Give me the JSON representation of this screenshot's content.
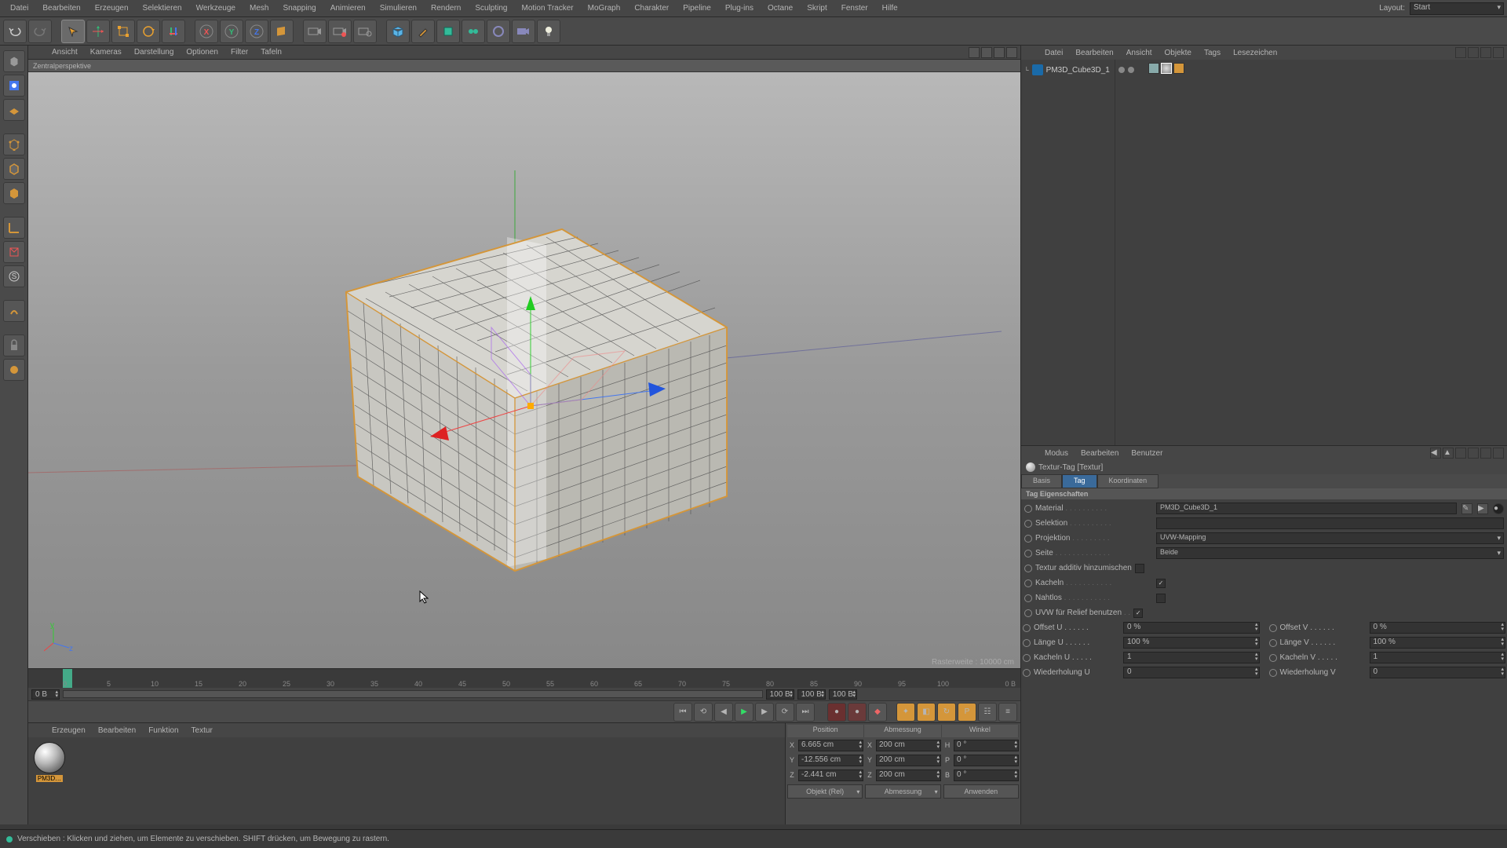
{
  "menubar": [
    "Datei",
    "Bearbeiten",
    "Erzeugen",
    "Selektieren",
    "Werkzeuge",
    "Mesh",
    "Snapping",
    "Animieren",
    "Simulieren",
    "Rendern",
    "Sculpting",
    "Motion Tracker",
    "MoGraph",
    "Charakter",
    "Pipeline",
    "Plug-ins",
    "Octane",
    "Skript",
    "Fenster",
    "Hilfe"
  ],
  "layout": {
    "label": "Layout:",
    "value": "Start"
  },
  "viewport": {
    "menu": [
      "Ansicht",
      "Kameras",
      "Darstellung",
      "Optionen",
      "Filter",
      "Tafeln"
    ],
    "label": "Zentralperspektive",
    "raster": "Rasterweite : 10000 cm"
  },
  "timeline": {
    "marks": [
      "0",
      "5",
      "10",
      "15",
      "20",
      "25",
      "30",
      "35",
      "40",
      "45",
      "50",
      "55",
      "60",
      "65",
      "70",
      "75",
      "80",
      "85",
      "90",
      "95",
      "100"
    ],
    "endbox": "0 B",
    "startF": "0 B",
    "endF": "100 B",
    "mid1": "100 B",
    "mid2": "100 B"
  },
  "materials": {
    "menu": [
      "Erzeugen",
      "Bearbeiten",
      "Funktion",
      "Textur"
    ],
    "name": "PM3D…"
  },
  "coords": {
    "hdr": [
      "Position",
      "Abmessung",
      "Winkel"
    ],
    "rows": [
      {
        "a": "X",
        "pos": "6.665 cm",
        "ab": "X",
        "dim": "200 cm",
        "an": "H",
        "ang": "0 °"
      },
      {
        "a": "Y",
        "pos": "-12.556 cm",
        "ab": "Y",
        "dim": "200 cm",
        "an": "P",
        "ang": "0 °"
      },
      {
        "a": "Z",
        "pos": "-2.441 cm",
        "ab": "Z",
        "dim": "200 cm",
        "an": "B",
        "ang": "0 °"
      }
    ],
    "btns": [
      "Objekt (Rel)",
      "Abmessung",
      "Anwenden"
    ]
  },
  "objects": {
    "menu": [
      "Datei",
      "Bearbeiten",
      "Ansicht",
      "Objekte",
      "Tags",
      "Lesezeichen"
    ],
    "item": "PM3D_Cube3D_1"
  },
  "attrs": {
    "menu": [
      "Modus",
      "Bearbeiten",
      "Benutzer"
    ],
    "title": "Textur-Tag [Textur]",
    "tabs": [
      "Basis",
      "Tag",
      "Koordinaten"
    ],
    "section": "Tag Eigenschaften",
    "material": {
      "label": "Material",
      "value": "PM3D_Cube3D_1"
    },
    "selektion": {
      "label": "Selektion",
      "value": ""
    },
    "projektion": {
      "label": "Projektion",
      "value": "UVW-Mapping"
    },
    "seite": {
      "label": "Seite",
      "value": "Beide"
    },
    "additiv": {
      "label": "Textur additiv hinzumischen",
      "checked": false
    },
    "kacheln": {
      "label": "Kacheln",
      "checked": true
    },
    "nahtlos": {
      "label": "Nahtlos",
      "checked": false
    },
    "relief": {
      "label": "UVW für Relief benutzen",
      "checked": true
    },
    "offsetU": {
      "label": "Offset U",
      "value": "0 %"
    },
    "offsetV": {
      "label": "Offset V",
      "value": "0 %"
    },
    "laengeU": {
      "label": "Länge U",
      "value": "100 %"
    },
    "laengeV": {
      "label": "Länge V",
      "value": "100 %"
    },
    "kachelnU": {
      "label": "Kacheln U",
      "value": "1"
    },
    "kachelnV": {
      "label": "Kacheln V",
      "value": "1"
    },
    "wiedU": {
      "label": "Wiederholung U",
      "value": "0"
    },
    "wiedV": {
      "label": "Wiederholung V",
      "value": "0"
    }
  },
  "status": "Verschieben : Klicken und ziehen, um Elemente zu verschieben. SHIFT drücken, um Bewegung zu rastern."
}
